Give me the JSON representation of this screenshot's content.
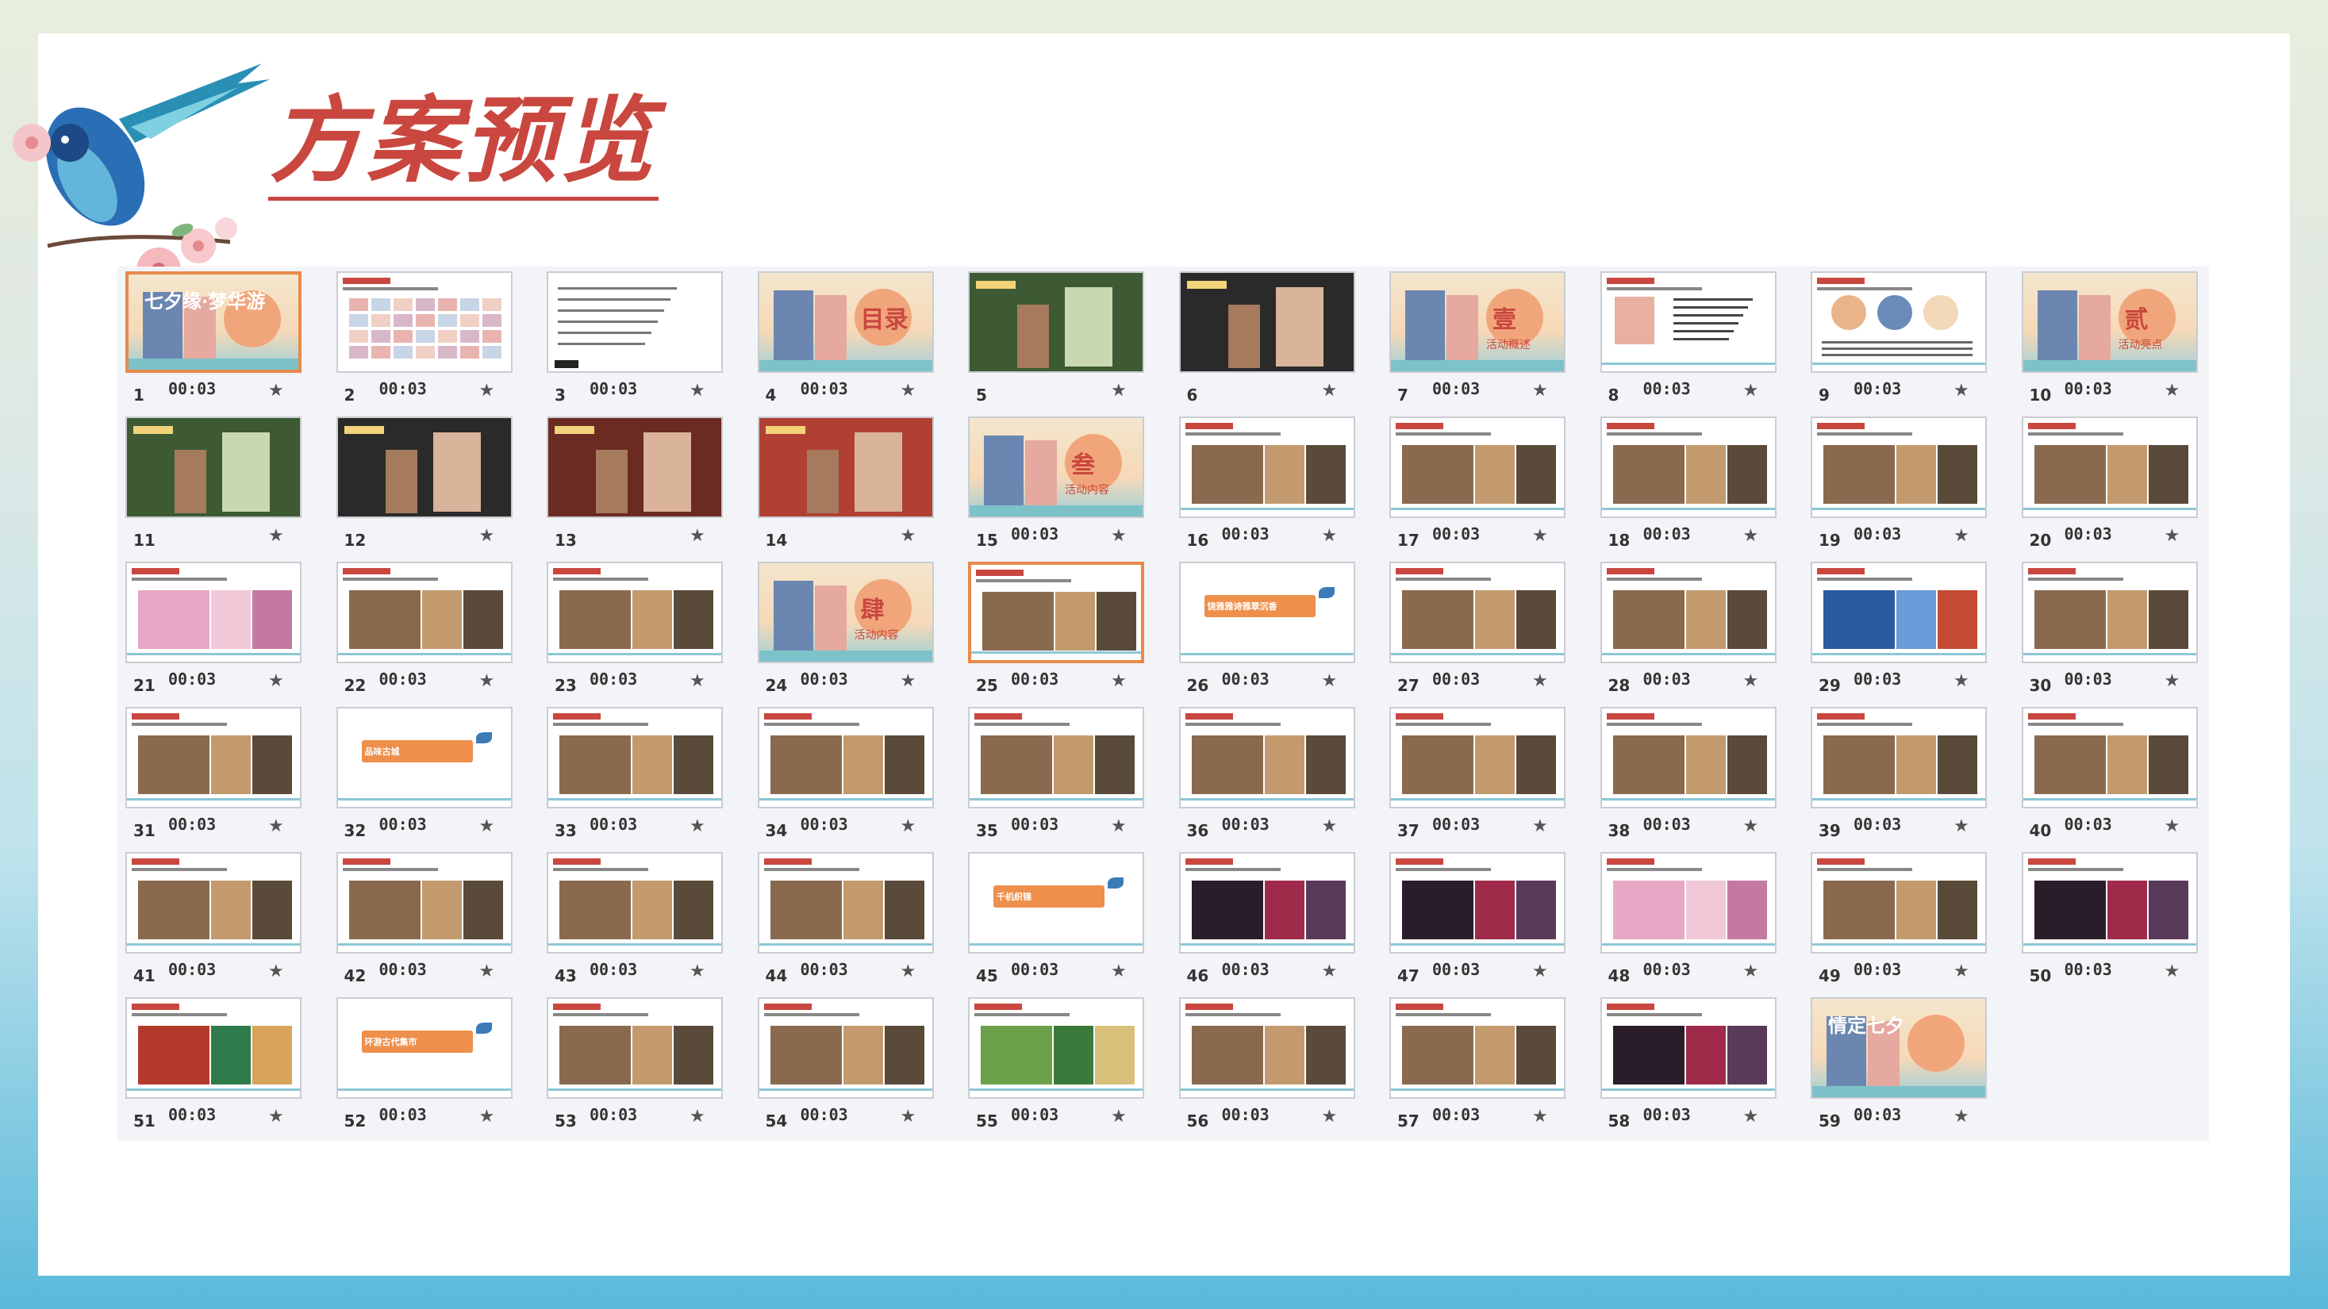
{
  "page": {
    "title": "方案预览"
  },
  "colors": {
    "title": "#c9473f",
    "selected_border": "#e88a4c"
  },
  "slides": [
    {
      "num": "1",
      "time": "00:03",
      "style": "cover",
      "text": "七夕缘·梦华游",
      "selected": true
    },
    {
      "num": "2",
      "time": "00:03",
      "style": "grid"
    },
    {
      "num": "3",
      "time": "00:03",
      "style": "text"
    },
    {
      "num": "4",
      "time": "00:03",
      "style": "toc",
      "text": "目录"
    },
    {
      "num": "5",
      "time": "",
      "style": "photo-green"
    },
    {
      "num": "6",
      "time": "",
      "style": "photo-dark"
    },
    {
      "num": "7",
      "time": "00:03",
      "style": "section",
      "text": "壹",
      "sub": "活动概述"
    },
    {
      "num": "8",
      "time": "00:03",
      "style": "white-text"
    },
    {
      "num": "9",
      "time": "00:03",
      "style": "white-circles"
    },
    {
      "num": "10",
      "time": "00:03",
      "style": "section",
      "text": "贰",
      "sub": "活动亮点"
    },
    {
      "num": "11",
      "time": "",
      "style": "photo-green"
    },
    {
      "num": "12",
      "time": "",
      "style": "photo-dark"
    },
    {
      "num": "13",
      "time": "",
      "style": "photo-red"
    },
    {
      "num": "14",
      "time": "",
      "style": "photo-red2"
    },
    {
      "num": "15",
      "time": "00:03",
      "style": "section",
      "text": "叁",
      "sub": "活动内容"
    },
    {
      "num": "16",
      "time": "00:03",
      "style": "white-photo"
    },
    {
      "num": "17",
      "time": "00:03",
      "style": "white-photo"
    },
    {
      "num": "18",
      "time": "00:03",
      "style": "white-photo"
    },
    {
      "num": "19",
      "time": "00:03",
      "style": "white-photo"
    },
    {
      "num": "20",
      "time": "00:03",
      "style": "white-photo"
    },
    {
      "num": "21",
      "time": "00:03",
      "style": "white-pink"
    },
    {
      "num": "22",
      "time": "00:03",
      "style": "white-photo"
    },
    {
      "num": "23",
      "time": "00:03",
      "style": "white-photo"
    },
    {
      "num": "24",
      "time": "00:03",
      "style": "section",
      "text": "肆",
      "sub": "活动内容"
    },
    {
      "num": "25",
      "time": "00:03",
      "style": "white-photo",
      "selected": true
    },
    {
      "num": "26",
      "time": "00:03",
      "style": "banner",
      "text": "饶雅雅诗雅翠沉香"
    },
    {
      "num": "27",
      "time": "00:03",
      "style": "white-photo"
    },
    {
      "num": "28",
      "time": "00:03",
      "style": "white-photo"
    },
    {
      "num": "29",
      "time": "00:03",
      "style": "white-blue"
    },
    {
      "num": "30",
      "time": "00:03",
      "style": "white-photo"
    },
    {
      "num": "31",
      "time": "00:03",
      "style": "white-photo"
    },
    {
      "num": "32",
      "time": "00:03",
      "style": "banner",
      "text": "品味古城"
    },
    {
      "num": "33",
      "time": "00:03",
      "style": "white-photo"
    },
    {
      "num": "34",
      "time": "00:03",
      "style": "white-photo"
    },
    {
      "num": "35",
      "time": "00:03",
      "style": "white-photo"
    },
    {
      "num": "36",
      "time": "00:03",
      "style": "white-photo"
    },
    {
      "num": "37",
      "time": "00:03",
      "style": "white-photo"
    },
    {
      "num": "38",
      "time": "00:03",
      "style": "white-photo"
    },
    {
      "num": "39",
      "time": "00:03",
      "style": "white-photo"
    },
    {
      "num": "40",
      "time": "00:03",
      "style": "white-photo"
    },
    {
      "num": "41",
      "time": "00:03",
      "style": "white-photo"
    },
    {
      "num": "42",
      "time": "00:03",
      "style": "white-photo"
    },
    {
      "num": "43",
      "time": "00:03",
      "style": "white-photo"
    },
    {
      "num": "44",
      "time": "00:03",
      "style": "white-photo"
    },
    {
      "num": "45",
      "time": "00:03",
      "style": "banner",
      "text": "千机织锦"
    },
    {
      "num": "46",
      "time": "00:03",
      "style": "white-dark"
    },
    {
      "num": "47",
      "time": "00:03",
      "style": "white-dark"
    },
    {
      "num": "48",
      "time": "00:03",
      "style": "white-pink"
    },
    {
      "num": "49",
      "time": "00:03",
      "style": "white-photo"
    },
    {
      "num": "50",
      "time": "00:03",
      "style": "white-dark"
    },
    {
      "num": "51",
      "time": "00:03",
      "style": "white-red"
    },
    {
      "num": "52",
      "time": "00:03",
      "style": "banner",
      "text": "环游古代集市"
    },
    {
      "num": "53",
      "time": "00:03",
      "style": "white-photo"
    },
    {
      "num": "54",
      "time": "00:03",
      "style": "white-photo"
    },
    {
      "num": "55",
      "time": "00:03",
      "style": "white-green"
    },
    {
      "num": "56",
      "time": "00:03",
      "style": "white-photo"
    },
    {
      "num": "57",
      "time": "00:03",
      "style": "white-photo"
    },
    {
      "num": "58",
      "time": "00:03",
      "style": "white-dark"
    },
    {
      "num": "59",
      "time": "00:03",
      "style": "cover",
      "text": "情定七夕"
    }
  ]
}
